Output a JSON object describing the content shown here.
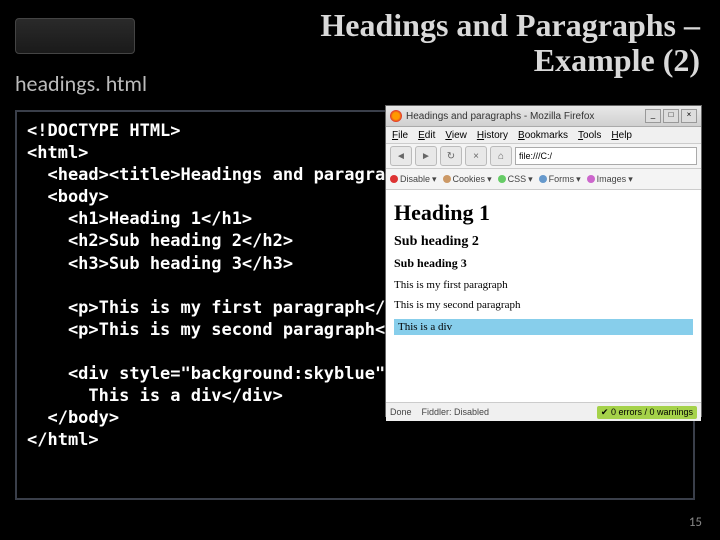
{
  "slide": {
    "title_line1": "Headings and Paragraphs –",
    "title_line2": "Example (2)",
    "filename": "headings. html",
    "page_number": "15"
  },
  "code": {
    "l1": "<!DOCTYPE HTML>",
    "l2": "<html>",
    "l3": "  <head><title>Headings and paragraphs</title></head>",
    "l4": "  <body>",
    "l5": "    <h1>Heading 1</h1>",
    "l6": "    <h2>Sub heading 2</h2>",
    "l7": "    <h3>Sub heading 3</h3>",
    "l8": "",
    "l9": "    <p>This is my first paragraph</p>",
    "l10": "    <p>This is my second paragraph</p>",
    "l11": "",
    "l12": "    <div style=\"background:skyblue\">",
    "l13": "      This is a div</div>",
    "l14": "  </body>",
    "l15": "</html>"
  },
  "browser": {
    "title": "Headings and paragraphs - Mozilla Firefox",
    "menu": [
      "File",
      "Edit",
      "View",
      "History",
      "Bookmarks",
      "Tools",
      "Help"
    ],
    "url": "file:///C:/",
    "toolbar2": {
      "disable": "Disable",
      "cookies": "Cookies",
      "css": "CSS",
      "forms": "Forms",
      "images": "Images"
    },
    "content": {
      "h1": "Heading 1",
      "h2": "Sub heading 2",
      "h3": "Sub heading 3",
      "p1": "This is my first paragraph",
      "p2": "This is my second paragraph",
      "div": "This is a div"
    },
    "status": {
      "left_done": "Done",
      "left_fiddler": "Fiddler: Disabled",
      "right": "0 errors / 0 warnings"
    }
  }
}
